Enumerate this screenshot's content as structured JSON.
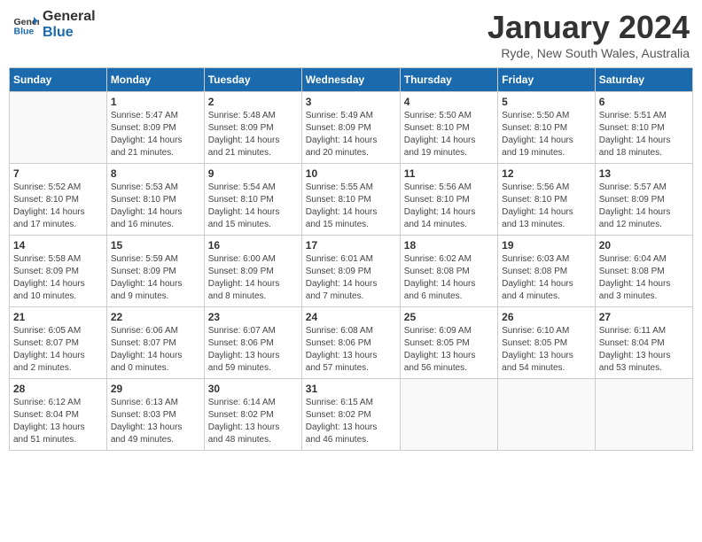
{
  "header": {
    "logo_line1": "General",
    "logo_line2": "Blue",
    "month": "January 2024",
    "location": "Ryde, New South Wales, Australia"
  },
  "weekdays": [
    "Sunday",
    "Monday",
    "Tuesday",
    "Wednesday",
    "Thursday",
    "Friday",
    "Saturday"
  ],
  "weeks": [
    [
      {
        "day": "",
        "info": ""
      },
      {
        "day": "1",
        "info": "Sunrise: 5:47 AM\nSunset: 8:09 PM\nDaylight: 14 hours\nand 21 minutes."
      },
      {
        "day": "2",
        "info": "Sunrise: 5:48 AM\nSunset: 8:09 PM\nDaylight: 14 hours\nand 21 minutes."
      },
      {
        "day": "3",
        "info": "Sunrise: 5:49 AM\nSunset: 8:09 PM\nDaylight: 14 hours\nand 20 minutes."
      },
      {
        "day": "4",
        "info": "Sunrise: 5:50 AM\nSunset: 8:10 PM\nDaylight: 14 hours\nand 19 minutes."
      },
      {
        "day": "5",
        "info": "Sunrise: 5:50 AM\nSunset: 8:10 PM\nDaylight: 14 hours\nand 19 minutes."
      },
      {
        "day": "6",
        "info": "Sunrise: 5:51 AM\nSunset: 8:10 PM\nDaylight: 14 hours\nand 18 minutes."
      }
    ],
    [
      {
        "day": "7",
        "info": "Sunrise: 5:52 AM\nSunset: 8:10 PM\nDaylight: 14 hours\nand 17 minutes."
      },
      {
        "day": "8",
        "info": "Sunrise: 5:53 AM\nSunset: 8:10 PM\nDaylight: 14 hours\nand 16 minutes."
      },
      {
        "day": "9",
        "info": "Sunrise: 5:54 AM\nSunset: 8:10 PM\nDaylight: 14 hours\nand 15 minutes."
      },
      {
        "day": "10",
        "info": "Sunrise: 5:55 AM\nSunset: 8:10 PM\nDaylight: 14 hours\nand 15 minutes."
      },
      {
        "day": "11",
        "info": "Sunrise: 5:56 AM\nSunset: 8:10 PM\nDaylight: 14 hours\nand 14 minutes."
      },
      {
        "day": "12",
        "info": "Sunrise: 5:56 AM\nSunset: 8:10 PM\nDaylight: 14 hours\nand 13 minutes."
      },
      {
        "day": "13",
        "info": "Sunrise: 5:57 AM\nSunset: 8:09 PM\nDaylight: 14 hours\nand 12 minutes."
      }
    ],
    [
      {
        "day": "14",
        "info": "Sunrise: 5:58 AM\nSunset: 8:09 PM\nDaylight: 14 hours\nand 10 minutes."
      },
      {
        "day": "15",
        "info": "Sunrise: 5:59 AM\nSunset: 8:09 PM\nDaylight: 14 hours\nand 9 minutes."
      },
      {
        "day": "16",
        "info": "Sunrise: 6:00 AM\nSunset: 8:09 PM\nDaylight: 14 hours\nand 8 minutes."
      },
      {
        "day": "17",
        "info": "Sunrise: 6:01 AM\nSunset: 8:09 PM\nDaylight: 14 hours\nand 7 minutes."
      },
      {
        "day": "18",
        "info": "Sunrise: 6:02 AM\nSunset: 8:08 PM\nDaylight: 14 hours\nand 6 minutes."
      },
      {
        "day": "19",
        "info": "Sunrise: 6:03 AM\nSunset: 8:08 PM\nDaylight: 14 hours\nand 4 minutes."
      },
      {
        "day": "20",
        "info": "Sunrise: 6:04 AM\nSunset: 8:08 PM\nDaylight: 14 hours\nand 3 minutes."
      }
    ],
    [
      {
        "day": "21",
        "info": "Sunrise: 6:05 AM\nSunset: 8:07 PM\nDaylight: 14 hours\nand 2 minutes."
      },
      {
        "day": "22",
        "info": "Sunrise: 6:06 AM\nSunset: 8:07 PM\nDaylight: 14 hours\nand 0 minutes."
      },
      {
        "day": "23",
        "info": "Sunrise: 6:07 AM\nSunset: 8:06 PM\nDaylight: 13 hours\nand 59 minutes."
      },
      {
        "day": "24",
        "info": "Sunrise: 6:08 AM\nSunset: 8:06 PM\nDaylight: 13 hours\nand 57 minutes."
      },
      {
        "day": "25",
        "info": "Sunrise: 6:09 AM\nSunset: 8:05 PM\nDaylight: 13 hours\nand 56 minutes."
      },
      {
        "day": "26",
        "info": "Sunrise: 6:10 AM\nSunset: 8:05 PM\nDaylight: 13 hours\nand 54 minutes."
      },
      {
        "day": "27",
        "info": "Sunrise: 6:11 AM\nSunset: 8:04 PM\nDaylight: 13 hours\nand 53 minutes."
      }
    ],
    [
      {
        "day": "28",
        "info": "Sunrise: 6:12 AM\nSunset: 8:04 PM\nDaylight: 13 hours\nand 51 minutes."
      },
      {
        "day": "29",
        "info": "Sunrise: 6:13 AM\nSunset: 8:03 PM\nDaylight: 13 hours\nand 49 minutes."
      },
      {
        "day": "30",
        "info": "Sunrise: 6:14 AM\nSunset: 8:02 PM\nDaylight: 13 hours\nand 48 minutes."
      },
      {
        "day": "31",
        "info": "Sunrise: 6:15 AM\nSunset: 8:02 PM\nDaylight: 13 hours\nand 46 minutes."
      },
      {
        "day": "",
        "info": ""
      },
      {
        "day": "",
        "info": ""
      },
      {
        "day": "",
        "info": ""
      }
    ]
  ]
}
